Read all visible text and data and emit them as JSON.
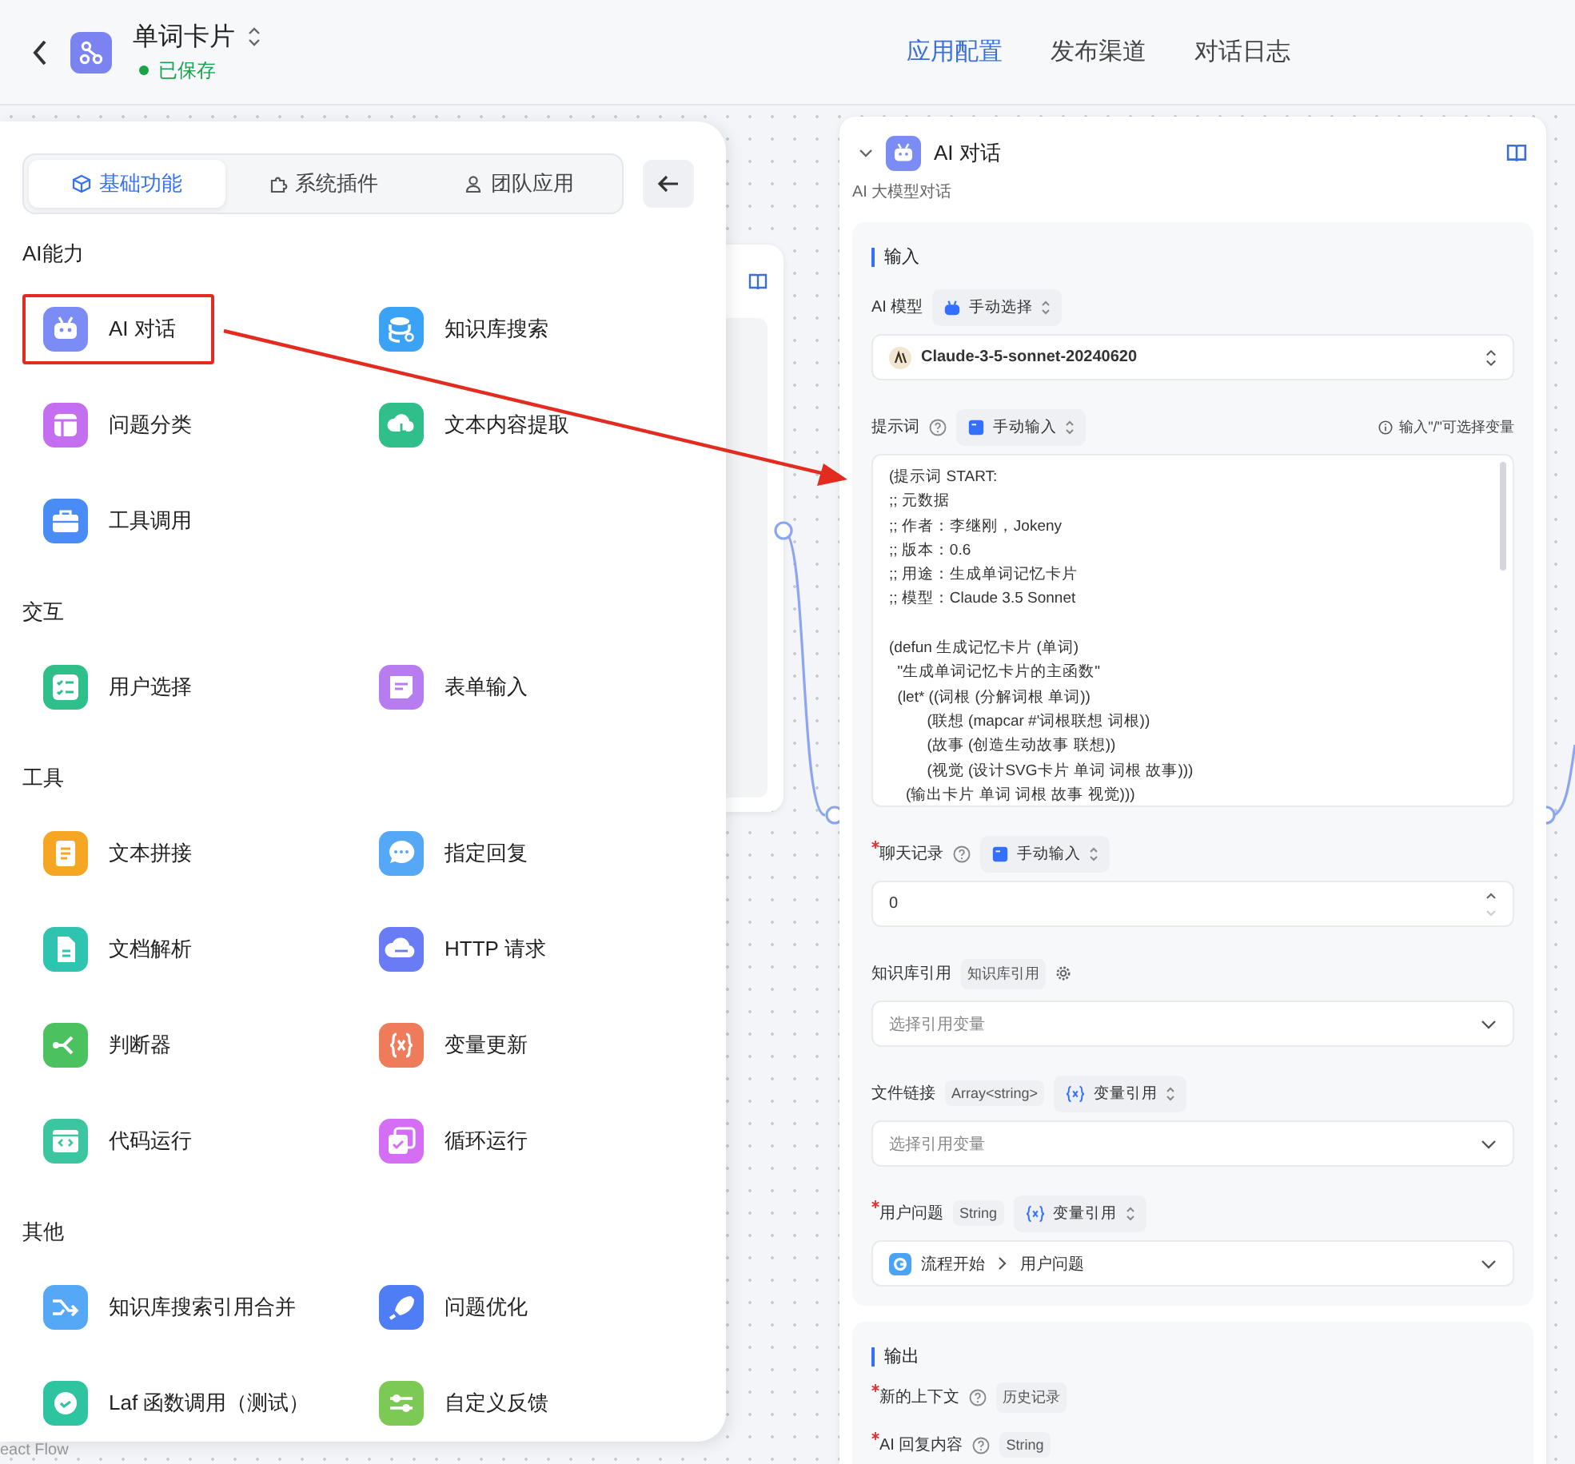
{
  "header": {
    "title": "单词卡片",
    "status": "已保存",
    "tabs": [
      {
        "label": "应用配置",
        "selected": true
      },
      {
        "label": "发布渠道",
        "selected": false
      },
      {
        "label": "对话日志",
        "selected": false
      }
    ]
  },
  "node_panel": {
    "tabs": [
      {
        "label": "基础功能",
        "selected": true
      },
      {
        "label": "系统插件",
        "selected": false
      },
      {
        "label": "团队应用",
        "selected": false
      }
    ],
    "sections": [
      {
        "title": "AI能力",
        "items": [
          {
            "label": "AI 对话",
            "color": "#7b8cf5",
            "highlighted": true
          },
          {
            "label": "知识库搜索",
            "color": "#3ba3f5",
            "highlighted": false
          },
          {
            "label": "问题分类",
            "color": "#c46ef0",
            "highlighted": false
          },
          {
            "label": "文本内容提取",
            "color": "#2fbf8a",
            "highlighted": false
          },
          {
            "label": "工具调用",
            "color": "#4a8cf5",
            "highlighted": false
          }
        ]
      },
      {
        "title": "交互",
        "items": [
          {
            "label": "用户选择",
            "color": "#2fbf8a",
            "highlighted": false
          },
          {
            "label": "表单输入",
            "color": "#b77cf0",
            "highlighted": false
          }
        ]
      },
      {
        "title": "工具",
        "items": [
          {
            "label": "文本拼接",
            "color": "#f5a623",
            "highlighted": false
          },
          {
            "label": "指定回复",
            "color": "#55a8f5",
            "highlighted": false
          },
          {
            "label": "文档解析",
            "color": "#2ec4b0",
            "highlighted": false
          },
          {
            "label": "HTTP 请求",
            "color": "#6a7cf5",
            "highlighted": false
          },
          {
            "label": "判断器",
            "color": "#4cc160",
            "highlighted": false
          },
          {
            "label": "变量更新",
            "color": "#ee7b5a",
            "highlighted": false
          },
          {
            "label": "代码运行",
            "color": "#3cc6a0",
            "highlighted": false
          },
          {
            "label": "循环运行",
            "color": "#d46ef5",
            "highlighted": false
          }
        ]
      },
      {
        "title": "其他",
        "items": [
          {
            "label": "知识库搜索引用合并",
            "color": "#55a8f5",
            "highlighted": false
          },
          {
            "label": "问题优化",
            "color": "#4f7df5",
            "highlighted": false
          },
          {
            "label": "Laf 函数调用（测试）",
            "color": "#2ec4a0",
            "highlighted": false
          },
          {
            "label": "自定义反馈",
            "color": "#7cc955",
            "highlighted": false
          }
        ]
      }
    ]
  },
  "canvas": {
    "attribution": "eact Flow",
    "node": {
      "title": "AI 对话",
      "subtitle": "AI 大模型对话",
      "input_section": {
        "title": "输入",
        "fields": [
          {
            "kind": "select",
            "label": "AI 模型",
            "required": false,
            "help": false,
            "mode": "手动选择",
            "value": "Claude-3-5-sonnet-20240620"
          },
          {
            "kind": "textarea",
            "label": "提示词",
            "required": false,
            "help": true,
            "mode": "手动输入",
            "hint": "输入\"/\"可选择变量",
            "value": "(提示词 START:\n;; 元数据\n;; 作者：李继刚，Jokeny\n;; 版本：0.6\n;; 用途：生成单词记忆卡片\n;; 模型：Claude 3.5 Sonnet\n\n(defun 生成记忆卡片 (单词)\n  \"生成单词记忆卡片的主函数\"\n  (let* ((词根 (分解词根 单词))\n         (联想 (mapcar #'词根联想 词根))\n         (故事 (创造生动故事 联想))\n         (视觉 (设计SVG卡片 单词 词根 故事)))\n    (输出卡片 单词 词根 故事 视觉)))"
          },
          {
            "kind": "number",
            "label": "聊天记录",
            "required": true,
            "help": true,
            "mode": "手动输入",
            "value": "0"
          },
          {
            "kind": "select",
            "label": "知识库引用",
            "required": false,
            "help": false,
            "type_tag": "知识库引用",
            "settings": true,
            "placeholder": "选择引用变量"
          },
          {
            "kind": "select",
            "label": "文件链接",
            "required": false,
            "help": false,
            "type_tag": "Array<string>",
            "mode": "变量引用",
            "placeholder": "选择引用变量"
          },
          {
            "kind": "reference",
            "label": "用户问题",
            "required": true,
            "help": false,
            "type_tag": "String",
            "mode": "变量引用",
            "source": "流程开始",
            "target": "用户问题"
          }
        ]
      },
      "output_section": {
        "title": "输出",
        "fields": [
          {
            "label": "新的上下文",
            "required": true,
            "help": true,
            "type_tag": "历史记录"
          },
          {
            "label": "AI 回复内容",
            "required": true,
            "help": true,
            "type_tag": "String"
          }
        ]
      }
    }
  }
}
